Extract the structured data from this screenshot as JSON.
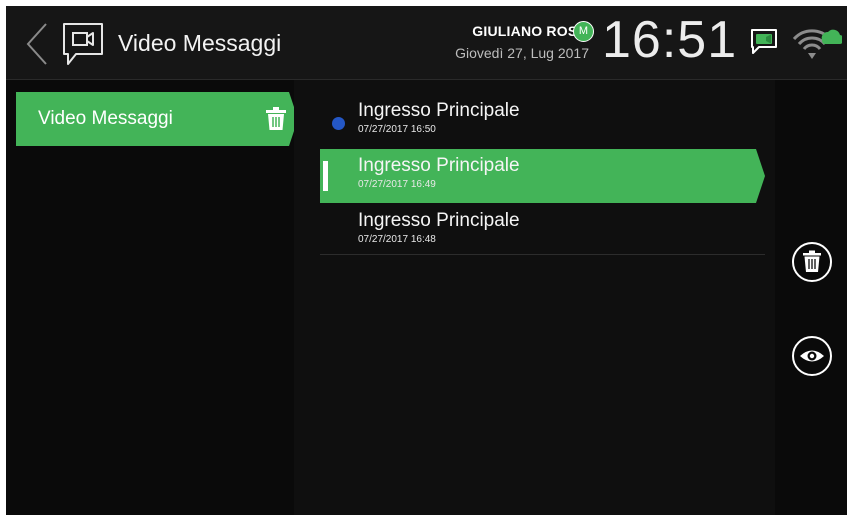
{
  "header": {
    "title": "Video Messaggi",
    "user_name": "GIULIANO ROSSI",
    "user_badge": "M",
    "date": "Giovedì 27, Lug 2017",
    "clock": "16:51"
  },
  "sidebar": {
    "items": [
      {
        "label": "Video Messaggi",
        "icon": "trash-icon",
        "active": true
      }
    ]
  },
  "messages": [
    {
      "name": "Ingresso Principale",
      "time": "07/27/2017 16:50",
      "unread": true,
      "selected": false
    },
    {
      "name": "Ingresso Principale",
      "time": "07/27/2017 16:49",
      "unread": false,
      "selected": true
    },
    {
      "name": "Ingresso Principale",
      "time": "07/27/2017 16:48",
      "unread": false,
      "selected": false
    }
  ],
  "actions": [
    {
      "icon": "trash-icon"
    },
    {
      "icon": "eye-icon"
    }
  ],
  "colors": {
    "accent_green": "#43b458",
    "unread_blue": "#2457c5",
    "background": "#0a0a0a"
  }
}
